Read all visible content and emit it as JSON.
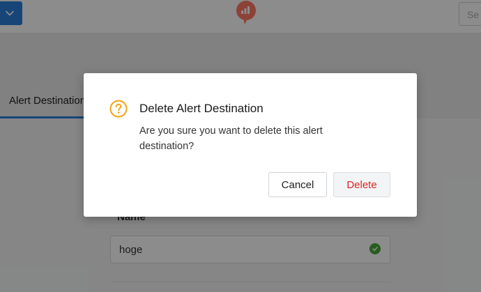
{
  "topbar": {
    "menu_icon": "chevron-down-icon",
    "logo_icon": "redash-logo",
    "search_placeholder": "Se"
  },
  "tabs": {
    "active_label": "Alert Destination"
  },
  "form": {
    "name_label": "Name",
    "name_value": "hoge",
    "valid_icon": "check-circle-icon"
  },
  "dialog": {
    "icon": "question-circle-icon",
    "title": "Delete Alert Destination",
    "message": "Are you sure you want to delete this alert destination?",
    "cancel_label": "Cancel",
    "delete_label": "Delete"
  },
  "colors": {
    "primary": "#2a7fdb",
    "danger": "#d9271f",
    "warning": "#f0a416",
    "success": "#4aa93b",
    "logo": "#ff7864"
  }
}
